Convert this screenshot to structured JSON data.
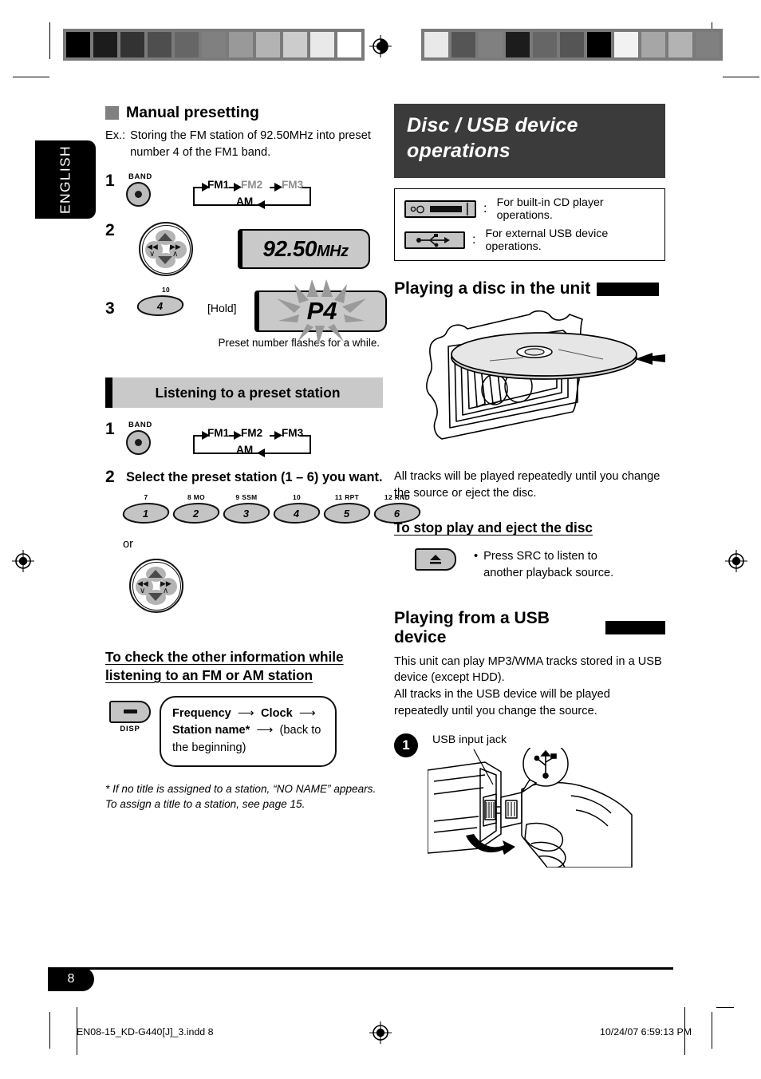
{
  "language_tab": "ENGLISH",
  "left": {
    "section_title": "Manual presetting",
    "example": {
      "label": "Ex.:",
      "text": "Storing the FM station of 92.50MHz into preset number 4 of the FM1 band."
    },
    "steps": {
      "one": {
        "number": "1",
        "button_caption": "BAND",
        "band_flow": {
          "fm1": "FM1",
          "fm2": "FM2",
          "fm3": "FM3",
          "am": "AM"
        }
      },
      "two": {
        "number": "2",
        "display_value": "92.50",
        "display_unit": "MHz"
      },
      "three": {
        "number": "3",
        "key_top_label": "10",
        "key_label": "4",
        "hold_label": "[Hold]",
        "display_value": "P4",
        "caption": "Preset number flashes for a while."
      }
    },
    "preset_section": {
      "heading": "Listening to a preset station",
      "step1": {
        "number": "1",
        "button_caption": "BAND",
        "band_flow": {
          "fm1": "FM1",
          "fm2": "FM2",
          "fm3": "FM3",
          "am": "AM"
        }
      },
      "step2": {
        "number": "2",
        "instruction": "Select the preset station (1 – 6) you want.",
        "keys": [
          {
            "top": "7",
            "label": "1"
          },
          {
            "top": "8  MO",
            "label": "2"
          },
          {
            "top": "9  SSM",
            "label": "3"
          },
          {
            "top": "10",
            "label": "4"
          },
          {
            "top": "11  RPT",
            "label": "5"
          },
          {
            "top": "12  RND",
            "label": "6"
          }
        ],
        "or_label": "or"
      }
    },
    "info_section": {
      "heading_line1": "To check the other information while",
      "heading_line2": "listening to an FM or AM station",
      "key_caption": "DISP",
      "flow_bold_1": "Frequency",
      "flow_bold_2": "Clock",
      "flow_bold_3": "Station name",
      "flow_star": "*",
      "flow_tail": "(back to the beginning)",
      "footnote": "*  If no title is assigned to a station, “NO NAME” appears. To assign a title to a station, see page 15."
    }
  },
  "right": {
    "chapter_title_line1": "Disc / USB device",
    "chapter_title_line2": "operations",
    "legend": [
      {
        "icon": "cd-slot-icon",
        "colon": ":",
        "text": "For built-in CD player operations."
      },
      {
        "icon": "usb-symbol-icon",
        "colon": ":",
        "text": "For external USB device operations."
      }
    ],
    "disc_section": {
      "heading": "Playing a disc in the unit",
      "body": "All tracks will be played repeatedly until you change the source or eject the disc.",
      "stop_heading": "To stop play and eject the disc",
      "bullet": "•",
      "bullet_text": "Press SRC to listen to another playback source."
    },
    "usb_section": {
      "heading": "Playing from a USB device",
      "body_1": "This unit can play MP3/WMA tracks stored in a USB device (except HDD).",
      "body_2": "All tracks in the USB device will be played repeatedly until you change the source.",
      "step_number": "1",
      "callout": "USB input jack"
    }
  },
  "footer": {
    "page_number": "8",
    "file_name": "EN08-15_KD-G440[J]_3.indd   8",
    "timestamp": "10/24/07   6:59:13 PM"
  },
  "colors": {
    "banner_bg": "#3b3b3b",
    "lcd_gray": "#c9c9c9",
    "key_gray": "#c4c4c4",
    "dim_text": "#8e8e8e"
  },
  "calibration": {
    "left_bar": [
      "#000000",
      "#1c1c1c",
      "#333333",
      "#4e4e4e",
      "#666666",
      "#808080",
      "#999999",
      "#b3b3b3",
      "#cccccc",
      "#e9e9e9",
      "#ffffff"
    ],
    "right_bar": [
      "#e9e9e9",
      "#555555",
      "#808080",
      "#1c1c1c",
      "#666666",
      "#555555",
      "#000000",
      "#f2f2f2",
      "#a6a6a6",
      "#b3b3b3",
      "#808080"
    ]
  }
}
